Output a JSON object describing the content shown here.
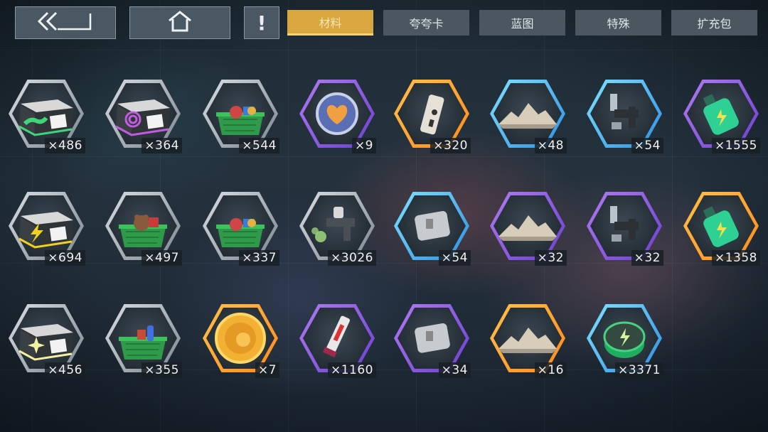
{
  "tabs": [
    {
      "label": "材料",
      "active": true
    },
    {
      "label": "夸夸卡",
      "active": false
    },
    {
      "label": "蓝图",
      "active": false
    },
    {
      "label": "特殊",
      "active": false
    },
    {
      "label": "扩充包",
      "active": false
    }
  ],
  "alert_glyph": "!",
  "inventory": [
    {
      "icon": "crate-green-icon",
      "qty": "×486",
      "rarity": "gray"
    },
    {
      "icon": "crate-purple-icon",
      "qty": "×364",
      "rarity": "gray"
    },
    {
      "icon": "junk-bin-icon",
      "qty": "×544",
      "rarity": "gray"
    },
    {
      "icon": "heart-badge-icon",
      "qty": "×9",
      "rarity": "purple"
    },
    {
      "icon": "device-icon",
      "qty": "×320",
      "rarity": "orange"
    },
    {
      "icon": "sand-pile-icon",
      "qty": "×48",
      "rarity": "blue"
    },
    {
      "icon": "robot-arm-icon",
      "qty": "×54",
      "rarity": "blue"
    },
    {
      "icon": "potion-green-icon",
      "qty": "×1555",
      "rarity": "purple"
    },
    {
      "icon": "crate-lightning-icon",
      "qty": "×694",
      "rarity": "gray"
    },
    {
      "icon": "toy-bin-icon",
      "qty": "×497",
      "rarity": "gray"
    },
    {
      "icon": "junk-bin-icon",
      "qty": "×337",
      "rarity": "gray"
    },
    {
      "icon": "spray-gun-icon",
      "qty": "×3026",
      "rarity": "gray"
    },
    {
      "icon": "chip-plate-icon",
      "qty": "×54",
      "rarity": "blue"
    },
    {
      "icon": "sand-pile-icon",
      "qty": "×32",
      "rarity": "purple"
    },
    {
      "icon": "robot-arm-icon",
      "qty": "×32",
      "rarity": "purple"
    },
    {
      "icon": "potion-green-icon",
      "qty": "×1358",
      "rarity": "orange"
    },
    {
      "icon": "crate-star-icon",
      "qty": "×456",
      "rarity": "gray"
    },
    {
      "icon": "boots-bin-icon",
      "qty": "×355",
      "rarity": "gray"
    },
    {
      "icon": "gold-coin-icon",
      "qty": "×7",
      "rarity": "orange"
    },
    {
      "icon": "syringe-icon",
      "qty": "×1160",
      "rarity": "purple"
    },
    {
      "icon": "chip-plate-icon",
      "qty": "×34",
      "rarity": "purple"
    },
    {
      "icon": "sand-pile-icon",
      "qty": "×16",
      "rarity": "orange"
    },
    {
      "icon": "energy-coin-icon",
      "qty": "×3371",
      "rarity": "blue"
    }
  ],
  "colors": {
    "tab_active": "#d9a640",
    "tab_inactive": "#4b5660",
    "rarity_gray": "#c9d0d6",
    "rarity_purple": "#9a63ea",
    "rarity_orange": "#ffa52e",
    "rarity_blue": "#4cc3f2"
  }
}
